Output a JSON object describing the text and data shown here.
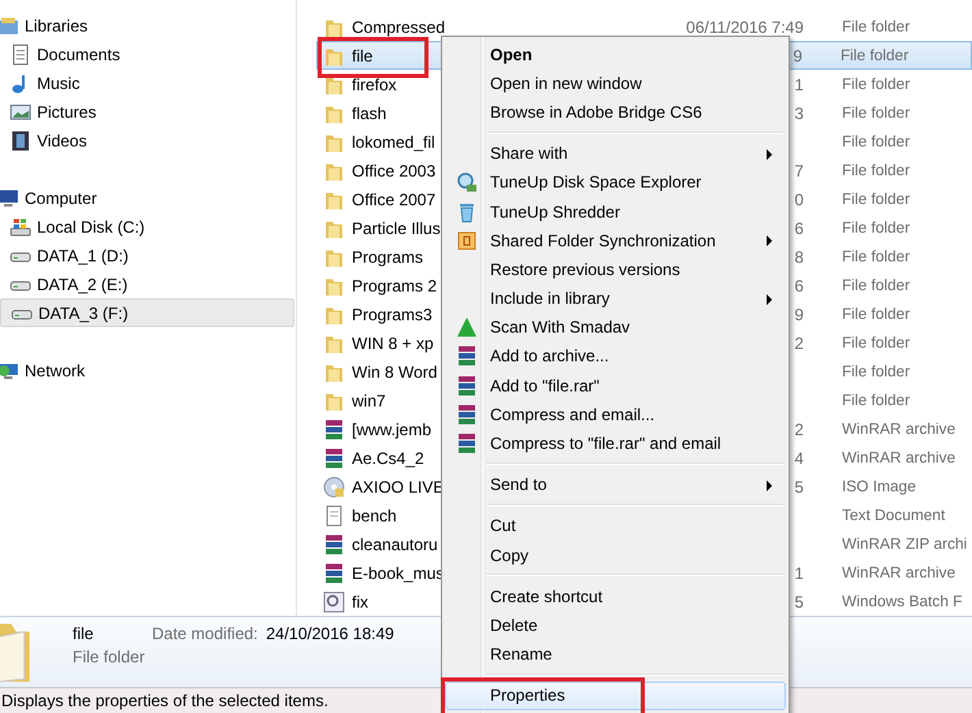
{
  "nav": [
    {
      "label": "Libraries",
      "kind": "libraries",
      "selected": false,
      "children": [
        {
          "label": "Documents",
          "kind": "documents",
          "selected": false
        },
        {
          "label": "Music",
          "kind": "music",
          "selected": false
        },
        {
          "label": "Pictures",
          "kind": "pictures",
          "selected": false
        },
        {
          "label": "Videos",
          "kind": "videos",
          "selected": false
        }
      ]
    },
    {
      "label": "Computer",
      "kind": "computer",
      "selected": false,
      "children": [
        {
          "label": "Local Disk (C:)",
          "kind": "system-disk",
          "selected": false
        },
        {
          "label": "DATA_1 (D:)",
          "kind": "disk",
          "selected": false
        },
        {
          "label": "DATA_2 (E:)",
          "kind": "disk",
          "selected": false
        },
        {
          "label": "DATA_3 (F:)",
          "kind": "disk",
          "selected": true
        }
      ]
    },
    {
      "label": "Network",
      "kind": "network",
      "selected": false
    }
  ],
  "files": [
    {
      "name": "Compressed",
      "date": "06/11/2016 7:49",
      "type": "File folder",
      "kind": "folder",
      "selected": false
    },
    {
      "name": "file",
      "date": "9",
      "type": "File folder",
      "kind": "folder",
      "selected": true
    },
    {
      "name": "firefox",
      "date": "1",
      "type": "File folder",
      "kind": "folder",
      "selected": false
    },
    {
      "name": "flash",
      "date": "3",
      "type": "File folder",
      "kind": "folder",
      "selected": false
    },
    {
      "name": "lokomed_fil",
      "type": "File folder",
      "kind": "folder",
      "selected": false
    },
    {
      "name": "Office 2003",
      "date": "7",
      "type": "File folder",
      "kind": "folder",
      "selected": false
    },
    {
      "name": "Office 2007",
      "date": "0",
      "type": "File folder",
      "kind": "folder",
      "selected": false
    },
    {
      "name": "Particle Illus",
      "date": "6",
      "type": "File folder",
      "kind": "folder",
      "selected": false
    },
    {
      "name": "Programs",
      "date": "8",
      "type": "File folder",
      "kind": "folder",
      "selected": false
    },
    {
      "name": "Programs 2",
      "date": "6",
      "type": "File folder",
      "kind": "folder",
      "selected": false
    },
    {
      "name": "Programs3",
      "date": "9",
      "type": "File folder",
      "kind": "folder",
      "selected": false
    },
    {
      "name": "WIN 8 + xp",
      "date": "2",
      "type": "File folder",
      "kind": "folder",
      "selected": false
    },
    {
      "name": "Win 8 Word",
      "type": "File folder",
      "kind": "folder",
      "selected": false
    },
    {
      "name": "win7",
      "type": "File folder",
      "kind": "folder",
      "selected": false
    },
    {
      "name": "[www.jemb",
      "date": "2",
      "type": "WinRAR archive",
      "kind": "archive",
      "selected": false
    },
    {
      "name": "Ae.Cs4_2",
      "date": "4",
      "type": "WinRAR archive",
      "kind": "archive",
      "selected": false
    },
    {
      "name": "AXIOO LIVE",
      "date": "5",
      "type": "ISO Image",
      "kind": "disc",
      "selected": false
    },
    {
      "name": "bench",
      "type": "Text Document",
      "kind": "text",
      "selected": false
    },
    {
      "name": "cleanautoru",
      "type": "WinRAR ZIP archi",
      "kind": "archive",
      "selected": false
    },
    {
      "name": "E-book_mus",
      "date": "1",
      "type": "WinRAR archive",
      "kind": "archive",
      "selected": false
    },
    {
      "name": "fix",
      "date": "5",
      "type": "Windows Batch F",
      "kind": "batch",
      "selected": false
    }
  ],
  "details": {
    "name": "file",
    "date_label": "Date modified:",
    "date": "24/10/2016 18:49",
    "type": "File folder"
  },
  "status_bar": "Displays the properties of the selected items.",
  "context_menu": [
    {
      "label": "Open",
      "kind": "plain",
      "default": true,
      "submenu": false,
      "selected": false
    },
    {
      "label": "Open in new window",
      "kind": "plain",
      "default": false,
      "submenu": false,
      "selected": false
    },
    {
      "label": "Browse in Adobe Bridge CS6",
      "kind": "plain",
      "default": false,
      "submenu": false,
      "selected": false
    },
    {
      "kind": "separator"
    },
    {
      "label": "Share with",
      "kind": "plain",
      "default": false,
      "submenu": true,
      "selected": false
    },
    {
      "label": "TuneUp Disk Space Explorer",
      "kind": "magnifier",
      "default": false,
      "submenu": false,
      "selected": false
    },
    {
      "label": "TuneUp Shredder",
      "kind": "trash",
      "default": false,
      "submenu": false,
      "selected": false
    },
    {
      "label": "Shared Folder Synchronization",
      "kind": "sync",
      "default": false,
      "submenu": true,
      "selected": false
    },
    {
      "label": "Restore previous versions",
      "kind": "plain",
      "default": false,
      "submenu": false,
      "selected": false
    },
    {
      "label": "Include in library",
      "kind": "plain",
      "default": false,
      "submenu": true,
      "selected": false
    },
    {
      "label": "Scan With Smadav",
      "kind": "triangle",
      "default": false,
      "submenu": false,
      "selected": false
    },
    {
      "label": "Add to archive...",
      "kind": "archive",
      "default": false,
      "submenu": false,
      "selected": false
    },
    {
      "label": "Add to \"file.rar\"",
      "kind": "archive",
      "default": false,
      "submenu": false,
      "selected": false
    },
    {
      "label": "Compress and email...",
      "kind": "archive",
      "default": false,
      "submenu": false,
      "selected": false
    },
    {
      "label": "Compress to \"file.rar\" and email",
      "kind": "archive",
      "default": false,
      "submenu": false,
      "selected": false
    },
    {
      "kind": "separator"
    },
    {
      "label": "Send to",
      "kind": "plain",
      "default": false,
      "submenu": true,
      "selected": false
    },
    {
      "kind": "separator"
    },
    {
      "label": "Cut",
      "kind": "plain",
      "default": false,
      "submenu": false,
      "selected": false
    },
    {
      "label": "Copy",
      "kind": "plain",
      "default": false,
      "submenu": false,
      "selected": false
    },
    {
      "kind": "separator"
    },
    {
      "label": "Create shortcut",
      "kind": "plain",
      "default": false,
      "submenu": false,
      "selected": false
    },
    {
      "label": "Delete",
      "kind": "plain",
      "default": false,
      "submenu": false,
      "selected": false
    },
    {
      "label": "Rename",
      "kind": "plain",
      "default": false,
      "submenu": false,
      "selected": false
    },
    {
      "kind": "separator"
    },
    {
      "label": "Properties",
      "kind": "plain",
      "default": false,
      "submenu": false,
      "selected": true
    }
  ]
}
